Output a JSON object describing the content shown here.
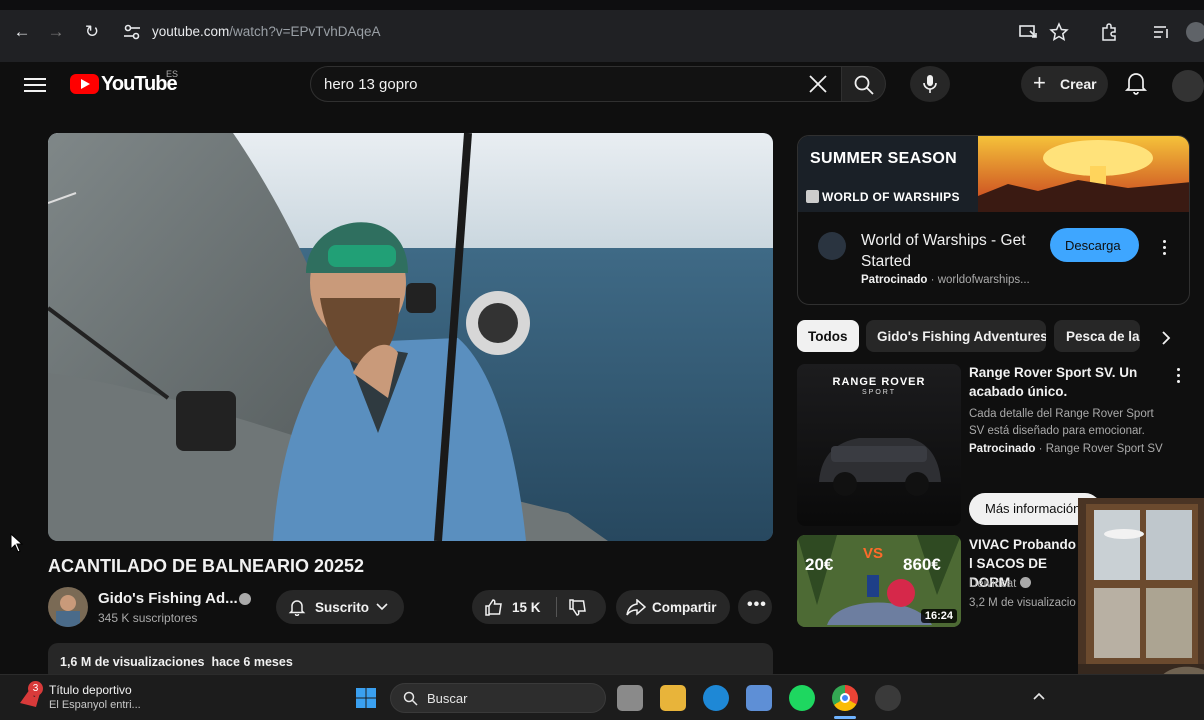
{
  "browser": {
    "url_host": "youtube.com",
    "url_path": "/watch?v=EPvTvhDAqeA"
  },
  "header": {
    "logo_text": "YouTube",
    "country_code": "ES",
    "search_query": "hero 13 gopro",
    "create_label": "Crear"
  },
  "video": {
    "title": "ACANTILADO DE BALNEARIO 20252",
    "channel_name": "Gido's Fishing Ad...",
    "subscribers": "345 K suscriptores",
    "subscribe_label": "Suscrito",
    "likes": "15 K",
    "share_label": "Compartir",
    "views": "1,6 M de visualizaciones",
    "age": "hace 6 meses"
  },
  "ad": {
    "banner_line1": "SUMMER SEASON",
    "banner_line2": "WORLD OF WARSHIPS",
    "title": "World of Warships - Get Started",
    "sponsored": "Patrocinado",
    "domain": "worldofwarships...",
    "cta": "Descarga"
  },
  "chips": [
    "Todos",
    "Gido's Fishing Adventures",
    "Pesca de la"
  ],
  "recommendations": [
    {
      "title": "Range Rover Sport SV. Un acabado único.",
      "description": "Cada detalle del Range Rover Sport SV está diseñado para emocionar.",
      "sponsored": "Patrocinado",
      "advertiser": "Range Rover Sport SV",
      "cta": "Más información",
      "thumb_brand": "RANGE ROVER",
      "thumb_sub": "SPORT"
    },
    {
      "title": "VIVAC Probando l SACOS DE DORM",
      "channel": "Deividcat",
      "views": "3,2 M de visualizacio",
      "duration": "16:24",
      "thumb_left": "20€",
      "thumb_vs": "VS",
      "thumb_right": "860€"
    }
  ],
  "taskbar": {
    "notification_count": "3",
    "news_title": "Título deportivo",
    "news_sub": "El Espanyol entri...",
    "search_label": "Buscar"
  },
  "colors": {
    "accent_red": "#ff0000",
    "cta_blue": "#3ea6ff",
    "background": "#0f0f0f"
  }
}
